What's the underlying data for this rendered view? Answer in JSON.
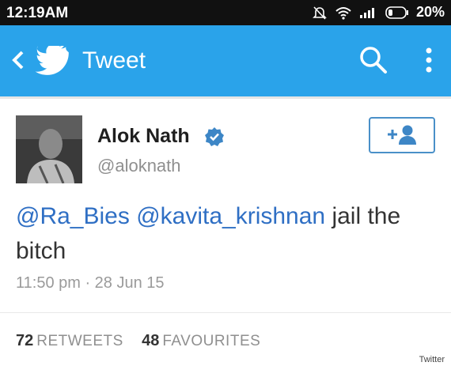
{
  "status_bar": {
    "time": "12:19AM",
    "battery": "20%"
  },
  "app_bar": {
    "title": "Tweet"
  },
  "tweet": {
    "author_name": "Alok Nath",
    "author_handle": "@aloknath",
    "mention_1": "@Ra_Bies",
    "mention_2": "@kavita_krishnan",
    "text_rest": " jail the bitch",
    "timestamp": "11:50 pm · 28 Jun 15"
  },
  "stats": {
    "retweets_count": "72",
    "retweets_label": "RETWEETS",
    "favourites_count": "48",
    "favourites_label": "FAVOURITES"
  },
  "credit": "Twitter",
  "colors": {
    "app_bar": "#2aa3ea",
    "status_bar": "#111111",
    "mention": "#2f6fc4",
    "verified": "#3d86c6"
  }
}
